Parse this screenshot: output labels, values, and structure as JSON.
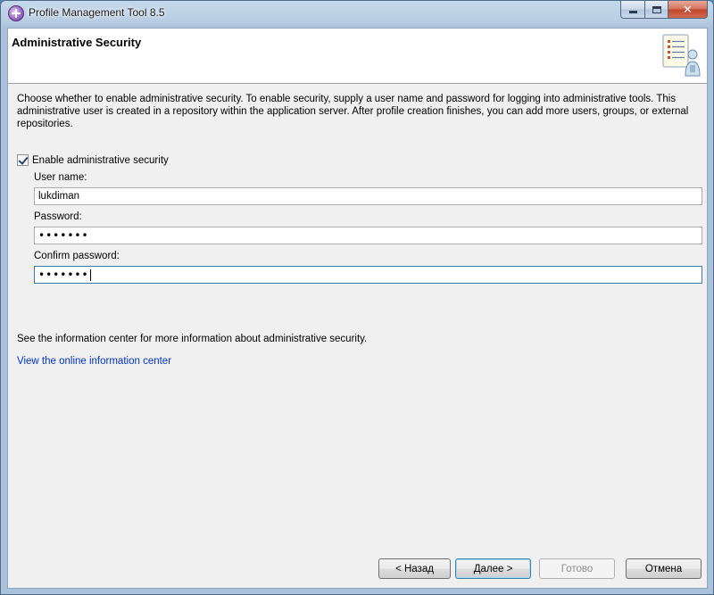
{
  "window": {
    "title": "Profile Management Tool 8.5"
  },
  "header": {
    "title": "Administrative Security"
  },
  "description": "Choose whether to enable administrative security. To enable security, supply a user name and password for logging into administrative tools. This administrative user is created in a repository within the application server. After profile creation finishes, you can add more users, groups, or external repositories.",
  "enable_security": {
    "label": "Enable administrative security",
    "checked": true
  },
  "fields": {
    "username_label": "User name:",
    "username_value": "lukdiman",
    "password_label": "Password:",
    "password_value": "•••••••",
    "confirm_label": "Confirm password:",
    "confirm_value": "•••••••"
  },
  "info": {
    "text": "See the information center for more information about administrative security.",
    "link": "View the online information center"
  },
  "buttons": {
    "back": "< Назад",
    "next": "Далее >",
    "finish": "Готово",
    "cancel": "Отмена"
  },
  "colors": {
    "link": "#0033cc",
    "accent": "#3c7fb1"
  }
}
